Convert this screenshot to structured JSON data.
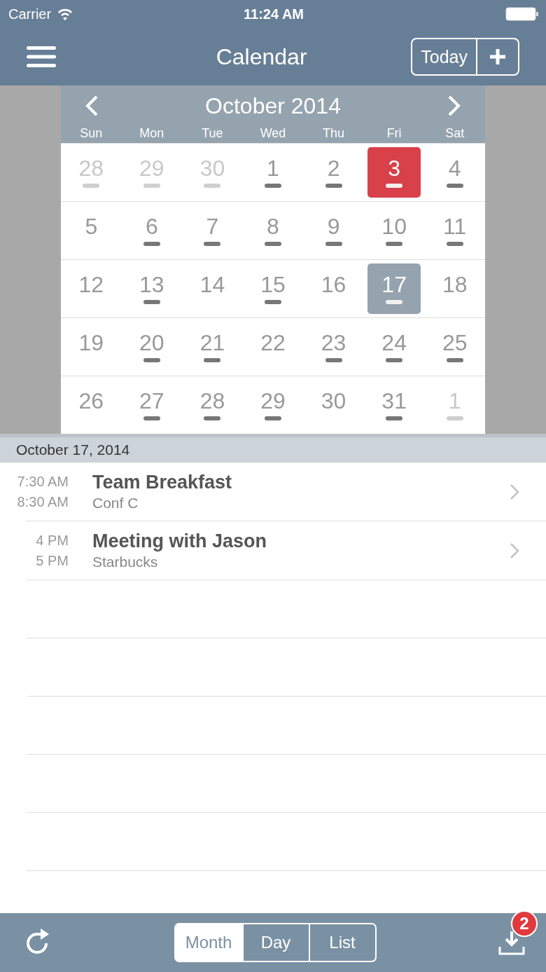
{
  "status_bar": {
    "carrier": "Carrier",
    "time": "11:24 AM"
  },
  "nav": {
    "title": "Calendar",
    "today_button": "Today"
  },
  "calendar": {
    "month": "October 2014",
    "weekdays": [
      "Sun",
      "Mon",
      "Tue",
      "Wed",
      "Thu",
      "Fri",
      "Sat"
    ],
    "weeks": [
      [
        {
          "day": "28",
          "muted": true,
          "events": true,
          "today": false,
          "selected": false
        },
        {
          "day": "29",
          "muted": true,
          "events": true,
          "today": false,
          "selected": false
        },
        {
          "day": "30",
          "muted": true,
          "events": true,
          "today": false,
          "selected": false
        },
        {
          "day": "1",
          "muted": false,
          "events": true,
          "today": false,
          "selected": false
        },
        {
          "day": "2",
          "muted": false,
          "events": true,
          "today": false,
          "selected": false
        },
        {
          "day": "3",
          "muted": false,
          "events": true,
          "today": true,
          "selected": false
        },
        {
          "day": "4",
          "muted": false,
          "events": true,
          "today": false,
          "selected": false
        }
      ],
      [
        {
          "day": "5",
          "muted": false,
          "events": false,
          "today": false,
          "selected": false
        },
        {
          "day": "6",
          "muted": false,
          "events": true,
          "today": false,
          "selected": false
        },
        {
          "day": "7",
          "muted": false,
          "events": true,
          "today": false,
          "selected": false
        },
        {
          "day": "8",
          "muted": false,
          "events": true,
          "today": false,
          "selected": false
        },
        {
          "day": "9",
          "muted": false,
          "events": true,
          "today": false,
          "selected": false
        },
        {
          "day": "10",
          "muted": false,
          "events": true,
          "today": false,
          "selected": false
        },
        {
          "day": "11",
          "muted": false,
          "events": true,
          "today": false,
          "selected": false
        }
      ],
      [
        {
          "day": "12",
          "muted": false,
          "events": false,
          "today": false,
          "selected": false
        },
        {
          "day": "13",
          "muted": false,
          "events": true,
          "today": false,
          "selected": false
        },
        {
          "day": "14",
          "muted": false,
          "events": false,
          "today": false,
          "selected": false
        },
        {
          "day": "15",
          "muted": false,
          "events": true,
          "today": false,
          "selected": false
        },
        {
          "day": "16",
          "muted": false,
          "events": false,
          "today": false,
          "selected": false
        },
        {
          "day": "17",
          "muted": false,
          "events": true,
          "today": false,
          "selected": true
        },
        {
          "day": "18",
          "muted": false,
          "events": false,
          "today": false,
          "selected": false
        }
      ],
      [
        {
          "day": "19",
          "muted": false,
          "events": false,
          "today": false,
          "selected": false
        },
        {
          "day": "20",
          "muted": false,
          "events": true,
          "today": false,
          "selected": false
        },
        {
          "day": "21",
          "muted": false,
          "events": true,
          "today": false,
          "selected": false
        },
        {
          "day": "22",
          "muted": false,
          "events": false,
          "today": false,
          "selected": false
        },
        {
          "day": "23",
          "muted": false,
          "events": true,
          "today": false,
          "selected": false
        },
        {
          "day": "24",
          "muted": false,
          "events": true,
          "today": false,
          "selected": false
        },
        {
          "day": "25",
          "muted": false,
          "events": true,
          "today": false,
          "selected": false
        }
      ],
      [
        {
          "day": "26",
          "muted": false,
          "events": false,
          "today": false,
          "selected": false
        },
        {
          "day": "27",
          "muted": false,
          "events": true,
          "today": false,
          "selected": false
        },
        {
          "day": "28",
          "muted": false,
          "events": true,
          "today": false,
          "selected": false
        },
        {
          "day": "29",
          "muted": false,
          "events": true,
          "today": false,
          "selected": false
        },
        {
          "day": "30",
          "muted": false,
          "events": false,
          "today": false,
          "selected": false
        },
        {
          "day": "31",
          "muted": false,
          "events": true,
          "today": false,
          "selected": false
        },
        {
          "day": "1",
          "muted": true,
          "events": true,
          "today": false,
          "selected": false
        }
      ]
    ]
  },
  "agenda": {
    "date": "October 17, 2014",
    "events": [
      {
        "start": "7:30 AM",
        "end": "8:30 AM",
        "title": "Team Breakfast",
        "location": "Conf C"
      },
      {
        "start": "4 PM",
        "end": "5 PM",
        "title": "Meeting with Jason",
        "location": "Starbucks"
      }
    ]
  },
  "toolbar": {
    "views": [
      {
        "label": "Month",
        "selected": true
      },
      {
        "label": "Day",
        "selected": false
      },
      {
        "label": "List",
        "selected": false
      }
    ],
    "download_badge": "2"
  }
}
